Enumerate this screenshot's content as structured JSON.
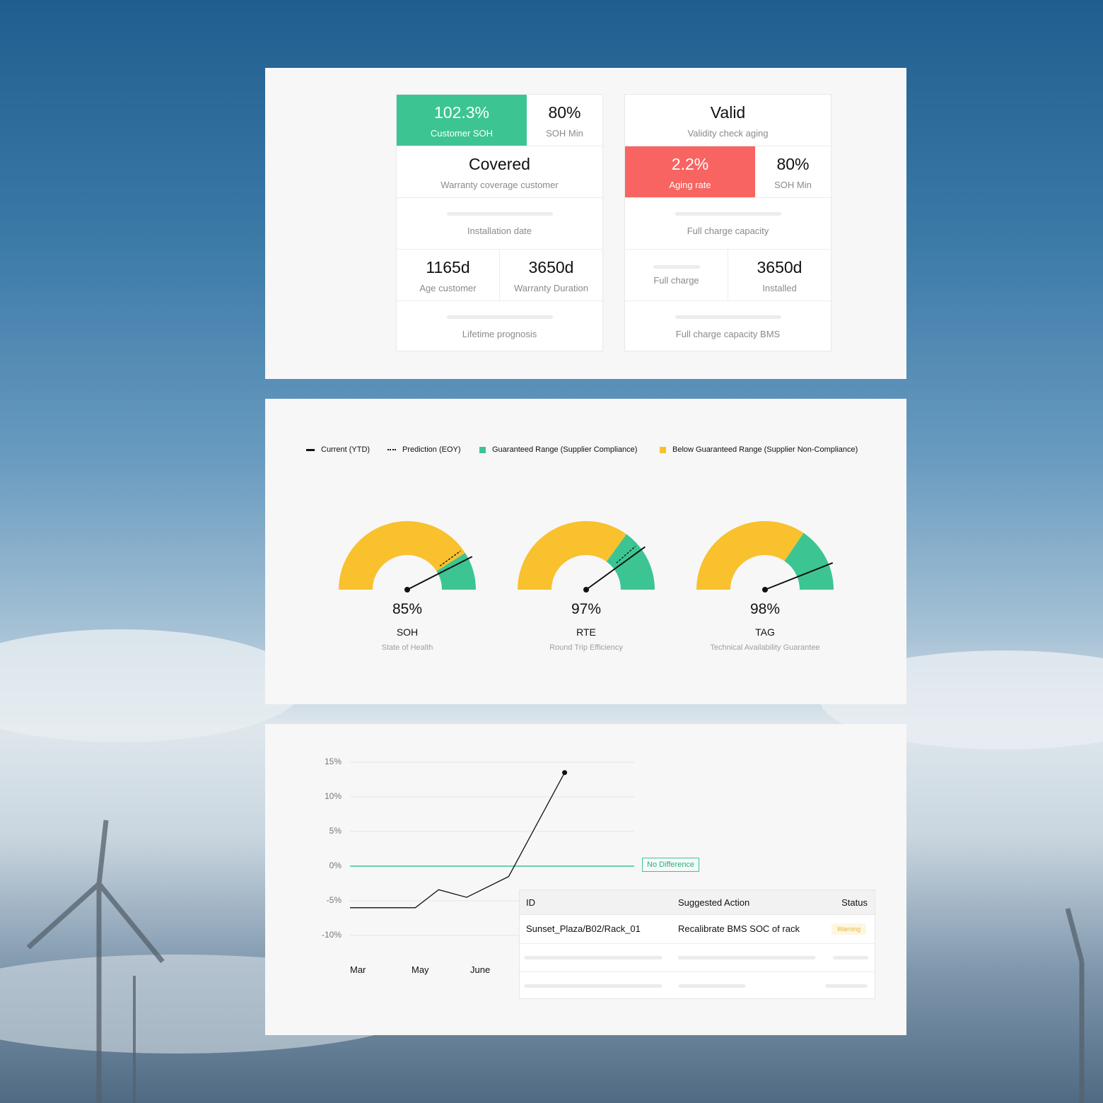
{
  "warranty_cards": {
    "left": {
      "customer_soh": {
        "value": "102.3%",
        "label": "Customer SOH"
      },
      "soh_min": {
        "value": "80%",
        "label": "SOH Min"
      },
      "coverage": {
        "value": "Covered",
        "label": "Warranty coverage customer"
      },
      "installation_date": {
        "label": "Installation date"
      },
      "age": {
        "value": "1165d",
        "label": "Age customer"
      },
      "warranty_duration": {
        "value": "3650d",
        "label": "Warranty Duration"
      },
      "lifetime": {
        "label": "Lifetime prognosis"
      }
    },
    "right": {
      "validity": {
        "value": "Valid",
        "label": "Validity check aging"
      },
      "aging_rate": {
        "value": "2.2%",
        "label": "Aging rate"
      },
      "soh_min": {
        "value": "80%",
        "label": "SOH Min"
      },
      "full_charge_capacity": {
        "label": "Full charge capacity"
      },
      "full_charge": {
        "label": "Full charge"
      },
      "installed": {
        "value": "3650d",
        "label": "Installed"
      },
      "fcc_bms": {
        "label": "Full charge capacity BMS"
      }
    },
    "colors": {
      "good": "#3cc592",
      "bad": "#f76462"
    }
  },
  "legend": {
    "current": "Current (YTD)",
    "prediction": "Prediction (EOY)",
    "guaranteed": "Guaranteed Range (Supplier Compliance)",
    "below": "Below Guaranteed Range (Supplier Non-Compliance)",
    "colors": {
      "guaranteed": "#3cc592",
      "below": "#f8c12d"
    }
  },
  "gauges": [
    {
      "value": "85%",
      "name": "SOH",
      "desc": "State of Health",
      "current": 0.85,
      "prediction": 0.8,
      "green_from": 0.82
    },
    {
      "value": "97%",
      "name": "RTE",
      "desc": "Round Trip Efficiency",
      "current": 0.8,
      "prediction": 0.77,
      "green_from": 0.7
    },
    {
      "value": "98%",
      "name": "TAG",
      "desc": "Technical Availability Guarantee",
      "current": 0.88,
      "green_from": 0.69
    }
  ],
  "chart_data": {
    "type": "line",
    "yticks": [
      "15%",
      "10%",
      "5%",
      "0%",
      "-5%",
      "-10%"
    ],
    "ylim": [
      -10,
      15
    ],
    "xlabels": [
      "Mar",
      "May",
      "June"
    ],
    "reference_label": "No Difference",
    "reference_value": 0,
    "series": [
      {
        "values": [
          {
            "x": 0,
            "y": -6
          },
          {
            "x": 1.4,
            "y": -6
          },
          {
            "x": 1.9,
            "y": -3.4
          },
          {
            "x": 2.5,
            "y": -4.5
          },
          {
            "x": 3.4,
            "y": -1.5
          },
          {
            "x": 4.6,
            "y": 13.5
          }
        ]
      }
    ]
  },
  "table": {
    "headers": {
      "id": "ID",
      "action": "Suggested Action",
      "status": "Status"
    },
    "rows": [
      {
        "id": "Sunset_Plaza/B02/Rack_01",
        "action": "Recalibrate BMS SOC of rack",
        "status": "Warning"
      }
    ]
  }
}
